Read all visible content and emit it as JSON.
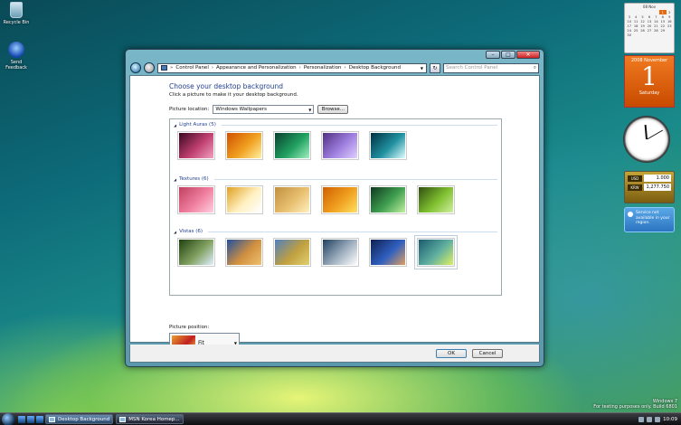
{
  "desktop": {
    "icons": [
      {
        "label": "Recycle Bin"
      },
      {
        "label": "Send Feedback"
      }
    ]
  },
  "gadgets": {
    "calendar_mini": {
      "header": "08 Nov",
      "rows": [
        [
          "",
          "",
          "",
          "",
          "",
          "1",
          "2"
        ],
        [
          "3",
          "4",
          "5",
          "6",
          "7",
          "8",
          "9"
        ],
        [
          "10",
          "11",
          "12",
          "13",
          "14",
          "15",
          "16"
        ],
        [
          "17",
          "18",
          "19",
          "20",
          "21",
          "22",
          "23"
        ],
        [
          "24",
          "25",
          "26",
          "27",
          "28",
          "29",
          ""
        ],
        [
          "30",
          "",
          "",
          "",
          "",
          "",
          ""
        ]
      ]
    },
    "date": {
      "month_year": "2008 November",
      "day": "1",
      "weekday": "Saturday"
    },
    "currency": {
      "rows": [
        {
          "code": "USD",
          "value": "1.000"
        },
        {
          "code": "KRW",
          "value": "1,277.750"
        }
      ]
    },
    "weather": {
      "text": "Service not available in your region."
    }
  },
  "window": {
    "title_buttons": {
      "minimize": "–",
      "maximize": "□",
      "close": "✕"
    },
    "breadcrumb": [
      "Control Panel",
      "Appearance and Personalization",
      "Personalization",
      "Desktop Background"
    ],
    "search_placeholder": "Search Control Panel",
    "heading": "Choose your desktop background",
    "subheading": "Click a picture to make it your desktop background.",
    "picture_location_label": "Picture location:",
    "picture_location_value": "Windows Wallpapers",
    "browse_label": "Browse...",
    "groups": [
      {
        "title": "Light Auras (5)",
        "thumbs": [
          {
            "colors": [
              "#3a0820",
              "#c04070",
              "#f0a0c0"
            ]
          },
          {
            "colors": [
              "#d05000",
              "#f0a020",
              "#fff0a0"
            ]
          },
          {
            "colors": [
              "#0a4030",
              "#20a060",
              "#a0f0c0"
            ]
          },
          {
            "colors": [
              "#503080",
              "#a080e0",
              "#e0d0ff"
            ]
          },
          {
            "colors": [
              "#003040",
              "#2090a0",
              "#e0ffff"
            ]
          }
        ]
      },
      {
        "title": "Textures (6)",
        "thumbs": [
          {
            "colors": [
              "#c04060",
              "#f080a0",
              "#ffd0e0"
            ]
          },
          {
            "colors": [
              "#e0a020",
              "#fff0c0",
              "#ffffff"
            ]
          },
          {
            "colors": [
              "#c09040",
              "#e8c070",
              "#fff0c0"
            ]
          },
          {
            "colors": [
              "#d06000",
              "#f0a020",
              "#ffe060"
            ]
          },
          {
            "colors": [
              "#103820",
              "#40a050",
              "#c0f0a0"
            ]
          },
          {
            "colors": [
              "#305010",
              "#80c030",
              "#d0f0a0"
            ]
          }
        ]
      },
      {
        "title": "Vistas (6)",
        "thumbs": [
          {
            "colors": [
              "#204010",
              "#80a060",
              "#e0f0ff"
            ]
          },
          {
            "colors": [
              "#2050a0",
              "#d09040",
              "#f0c070"
            ]
          },
          {
            "colors": [
              "#5080c0",
              "#c0a040",
              "#e0d070"
            ]
          },
          {
            "colors": [
              "#204060",
              "#a0b0c0",
              "#ffffff"
            ]
          },
          {
            "colors": [
              "#102050",
              "#3060c0",
              "#e0a060"
            ]
          },
          {
            "colors": [
              "#1a5a70",
              "#60b0a0",
              "#e0f060"
            ]
          }
        ]
      }
    ],
    "picture_position_label": "Picture position:",
    "picture_position_value": "Fit",
    "ok_label": "OK",
    "cancel_label": "Cancel"
  },
  "taskbar": {
    "tasks": [
      {
        "label": "Desktop Background",
        "active": true
      },
      {
        "label": "MSN Korea Homep...",
        "active": false
      }
    ],
    "clock": "10:09"
  },
  "watermark": {
    "line1": "Windows 7",
    "line2": "For testing purposes only. Build 6801"
  }
}
